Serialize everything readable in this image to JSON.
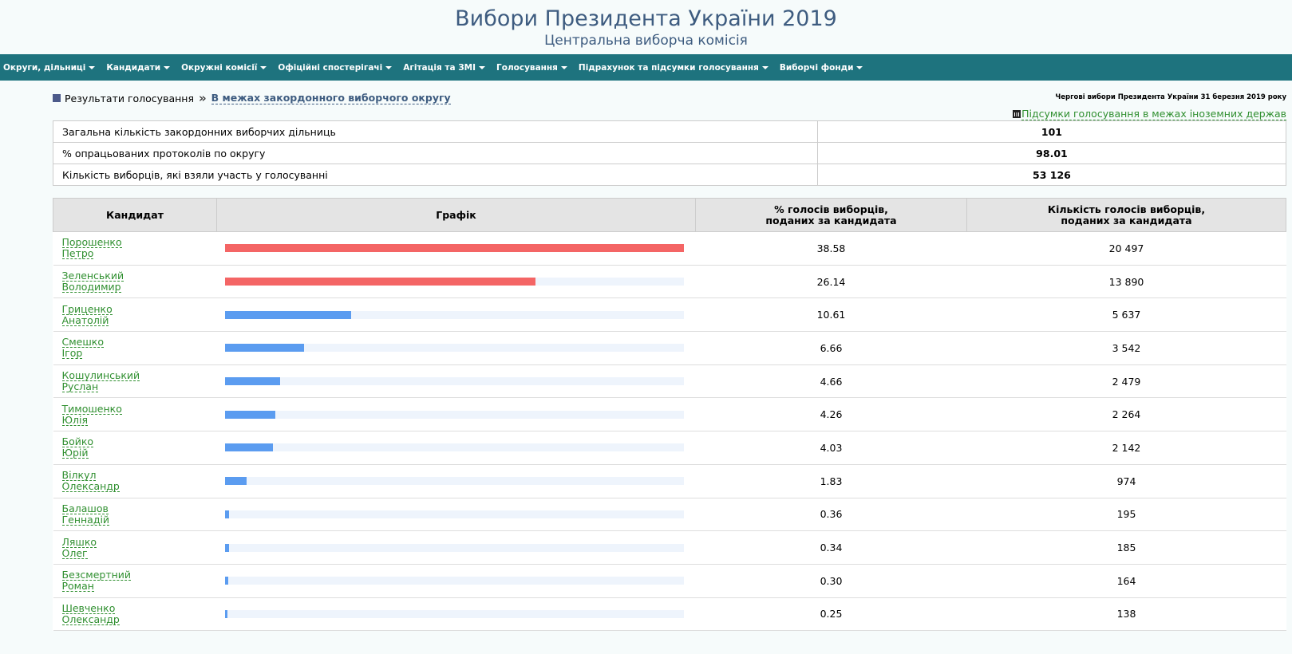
{
  "header": {
    "title": "Вибори Президента України 2019",
    "subtitle": "Центральна виборча комісія"
  },
  "nav": [
    {
      "label": "Округи, дільниці"
    },
    {
      "label": "Кандидати"
    },
    {
      "label": "Окружні комісії"
    },
    {
      "label": "Офіційні спостерігачі"
    },
    {
      "label": "Агітація та ЗМІ"
    },
    {
      "label": "Голосування"
    },
    {
      "label": "Підрахунок та підсумки голосування"
    },
    {
      "label": "Виборчі фонди"
    }
  ],
  "breadcrumb": {
    "parent": "Результати голосування",
    "separator": "»",
    "current": "В межах закордонного виборчого округу",
    "election_date": "Чергові вибори Президента України 31 березня 2019 року"
  },
  "summary_link": "Підсумки голосування в межах іноземних держав",
  "stats": [
    {
      "label": "Загальна кількість закордонних виборчих дільниць",
      "value": "101"
    },
    {
      "label": "% опрацьованих протоколів по округу",
      "value": "98.01"
    },
    {
      "label": "Кількість виборців, які взяли участь у голосуванні",
      "value": "53 126"
    }
  ],
  "results": {
    "headers": {
      "candidate": "Кандидат",
      "graph": "Графік",
      "pct_line1": "% голосів виборців,",
      "pct_line2": "поданих за кандидата",
      "votes_line1": "Кількість голосів виборців,",
      "votes_line2": "поданих за кандидата"
    },
    "bar_colors": {
      "top": "#f46565",
      "other": "#5b9cf0",
      "track": "#eef4fc"
    },
    "max_pct": 38.58,
    "rows": [
      {
        "surname": "Порошенко",
        "given": "Петро",
        "pct": 38.58,
        "pct_text": "38.58",
        "votes": "20 497",
        "top": true
      },
      {
        "surname": "Зеленський",
        "given": "Володимир",
        "pct": 26.14,
        "pct_text": "26.14",
        "votes": "13 890",
        "top": true
      },
      {
        "surname": "Гриценко",
        "given": "Анатолій",
        "pct": 10.61,
        "pct_text": "10.61",
        "votes": "5 637",
        "top": false
      },
      {
        "surname": "Смешко",
        "given": "Ігор",
        "pct": 6.66,
        "pct_text": "6.66",
        "votes": "3 542",
        "top": false
      },
      {
        "surname": "Кошулинський",
        "given": "Руслан",
        "pct": 4.66,
        "pct_text": "4.66",
        "votes": "2 479",
        "top": false
      },
      {
        "surname": "Тимошенко",
        "given": "Юлія",
        "pct": 4.26,
        "pct_text": "4.26",
        "votes": "2 264",
        "top": false
      },
      {
        "surname": "Бойко",
        "given": "Юрій",
        "pct": 4.03,
        "pct_text": "4.03",
        "votes": "2 142",
        "top": false
      },
      {
        "surname": "Вілкул",
        "given": "Олександр",
        "pct": 1.83,
        "pct_text": "1.83",
        "votes": "974",
        "top": false
      },
      {
        "surname": "Балашов",
        "given": "Геннадій",
        "pct": 0.36,
        "pct_text": "0.36",
        "votes": "195",
        "top": false
      },
      {
        "surname": "Ляшко",
        "given": "Олег",
        "pct": 0.34,
        "pct_text": "0.34",
        "votes": "185",
        "top": false
      },
      {
        "surname": "Безсмертний",
        "given": "Роман",
        "pct": 0.3,
        "pct_text": "0.30",
        "votes": "164",
        "top": false
      },
      {
        "surname": "Шевченко",
        "given": "Олександр",
        "pct": 0.25,
        "pct_text": "0.25",
        "votes": "138",
        "top": false
      }
    ]
  }
}
